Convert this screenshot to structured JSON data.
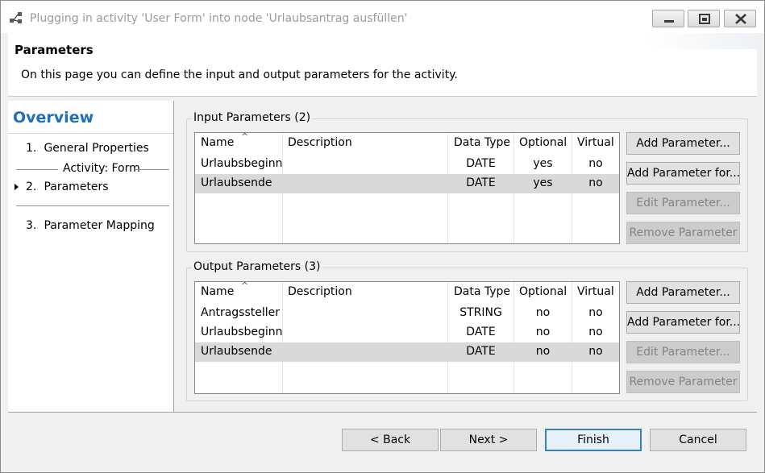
{
  "window": {
    "title": "Plugging in activity 'User Form' into node 'Urlaubsantrag ausfüllen'"
  },
  "header": {
    "title": "Parameters",
    "description": "On this page you can define the input and output parameters for the activity."
  },
  "nav": {
    "title": "Overview",
    "items": [
      {
        "num": "1.",
        "label": "General Properties"
      },
      {
        "num": "2.",
        "label": "Parameters",
        "current": true
      },
      {
        "num": "3.",
        "label": "Parameter Mapping"
      }
    ],
    "group_label": "Activity: Form"
  },
  "columns": [
    "Name",
    "Description",
    "Data Type",
    "Optional",
    "Virtual"
  ],
  "input": {
    "label": "Input Parameters (2)",
    "rows": [
      {
        "name": "Urlaubsbeginn",
        "description": "",
        "type": "DATE",
        "optional": "yes",
        "virtual": "no"
      },
      {
        "name": "Urlaubsende",
        "description": "",
        "type": "DATE",
        "optional": "yes",
        "virtual": "no",
        "selected": true
      }
    ]
  },
  "output": {
    "label": "Output Parameters (3)",
    "rows": [
      {
        "name": "Antragssteller",
        "description": "",
        "type": "STRING",
        "optional": "no",
        "virtual": "no"
      },
      {
        "name": "Urlaubsbeginn",
        "description": "",
        "type": "DATE",
        "optional": "no",
        "virtual": "no"
      },
      {
        "name": "Urlaubsende",
        "description": "",
        "type": "DATE",
        "optional": "no",
        "virtual": "no",
        "selected": true
      }
    ]
  },
  "side_buttons": {
    "add": "Add Parameter...",
    "add_for": "Add Parameter for...",
    "edit": "Edit Parameter...",
    "remove": "Remove Parameter"
  },
  "footer": {
    "back": "< Back",
    "next": "Next >",
    "finish": "Finish",
    "cancel": "Cancel"
  },
  "icons": {
    "app": "workflow-plugin-icon",
    "minimize": "minimize-icon",
    "maximize": "maximize-icon",
    "close": "close-icon",
    "sort": "sort-ascending-icon",
    "current": "current-step-arrow-icon"
  },
  "colors": {
    "accent": "#1f6fc0",
    "selected_row": "#d9d9d9",
    "default_button_border": "#3c7fb1",
    "close_button": "#c75050"
  }
}
